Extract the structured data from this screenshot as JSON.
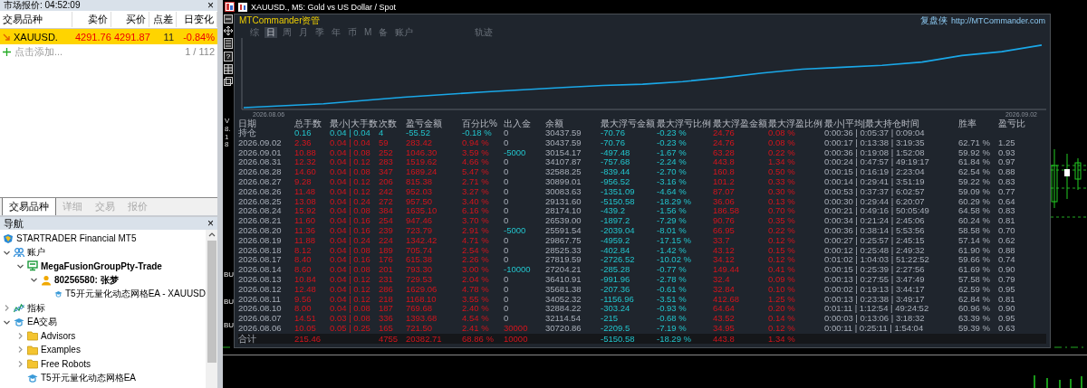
{
  "market_watch": {
    "title": "市场报价: 04:52:09",
    "close": "×",
    "columns": [
      "交易品种",
      "卖价",
      "买价",
      "点差",
      "日变化"
    ],
    "rows": [
      {
        "symbol": "XAUUSD.",
        "bid": "4291.76",
        "ask": "4291.87",
        "spread": "11",
        "change": "-0.84%",
        "falling": true,
        "selected": true
      }
    ],
    "add_label": "点击添加...",
    "count": "1 / 112",
    "tabs": [
      {
        "label": "交易品种",
        "selected": true
      },
      {
        "label": "详细",
        "selected": false
      },
      {
        "label": "交易",
        "selected": false
      },
      {
        "label": "报价",
        "selected": false
      }
    ]
  },
  "navigator": {
    "title": "导航",
    "close": "×",
    "tree": [
      {
        "label": "STARTRADER Financial MT5",
        "kind": "broker",
        "current": false
      },
      {
        "label": "账户",
        "kind": "accounts",
        "expanded": true,
        "current": false,
        "children": [
          {
            "label": "MegaFusionGroupPty-Trade",
            "kind": "server",
            "expanded": true,
            "current": true,
            "children": [
              {
                "label": "80256580: 张梦",
                "kind": "user",
                "expanded": true,
                "current": true,
                "children": [
                  {
                    "label": "T5开元量化动态网格EA - XAUUSD",
                    "kind": "expert",
                    "current": false
                  }
                ]
              }
            ]
          }
        ]
      },
      {
        "label": "指标",
        "kind": "indicators",
        "expanded": false,
        "current": false
      },
      {
        "label": "EA交易",
        "kind": "expert",
        "expanded": true,
        "current": false,
        "children": [
          {
            "label": "Advisors",
            "kind": "folder",
            "expanded": false,
            "current": false
          },
          {
            "label": "Examples",
            "kind": "folder",
            "expanded": false,
            "current": false
          },
          {
            "label": "Free Robots",
            "kind": "folder",
            "expanded": false,
            "current": false
          },
          {
            "label": "T5开元量化动态网格EA",
            "kind": "expert",
            "current": false
          }
        ]
      }
    ]
  },
  "chart_window": {
    "title": "XAUUSD., M5: Gold vs US Dollar / Spot",
    "toolbar_help": "?",
    "version": "V8.18",
    "chart_labels": [
      "BU",
      "BU",
      "BU"
    ],
    "panel": {
      "title": "MTCommander资管",
      "brand": "复盘侠",
      "url": "http://MTCommander.com",
      "tabs": [
        {
          "label": "综",
          "selected": false
        },
        {
          "label": "日",
          "selected": true
        },
        {
          "label": "周",
          "selected": false
        },
        {
          "label": "月",
          "selected": false
        },
        {
          "label": "季",
          "selected": false
        },
        {
          "label": "年",
          "selected": false
        },
        {
          "label": "币",
          "selected": false
        },
        {
          "label": "M",
          "selected": false
        },
        {
          "label": "备",
          "selected": false
        },
        {
          "label": "账户",
          "selected": false
        },
        {
          "label": "轨迹",
          "selected": false
        }
      ],
      "equity_chart": {
        "start_label": "2026.08.06",
        "end_label": "2026.09.02"
      },
      "columns": [
        "日期",
        "总手数",
        "最小|大手数",
        "次数",
        "盈亏金额",
        "百分比%",
        "出入金",
        "余额",
        "最大浮亏金额",
        "最大浮亏比例",
        "最大浮盈金额",
        "最大浮盈比例",
        "最小|平均|最大持仓时间",
        "胜率",
        "盈亏比"
      ],
      "rows": [
        {
          "kind": "holding",
          "loss": true,
          "cash_in": false,
          "cash_out": false,
          "date": "持仓",
          "lots": "0.16",
          "lot_range": "0.04 | 0.04",
          "trades": "4",
          "pnl": "-55.52",
          "pct": "-0.18 %",
          "cash_flow": "0",
          "balance": "30437.59",
          "max_float_loss": "-70.76",
          "max_float_loss_pct": "-0.23 %",
          "max_float_profit": "24.76",
          "max_float_profit_pct": "0.08 %",
          "hold_times": "0:00:36 | 0:05:37 | 0:09:04"
        },
        {
          "kind": "day",
          "date": "2026.09.02",
          "loss": false,
          "cash_in": false,
          "cash_out": false,
          "lots": "2.36",
          "lot_range": "0.04 | 0.04",
          "trades": "59",
          "pnl": "283.42",
          "pct": "0.94 %",
          "cash_flow": "0",
          "balance": "30437.59",
          "max_float_loss": "-70.76",
          "max_float_loss_pct": "-0.23 %",
          "max_float_profit": "24.76",
          "max_float_profit_pct": "0.08 %",
          "hold_times": "0:00:17 | 0:13:38 | 3:19:35",
          "win_rate": "62.71 %",
          "pl_ratio": "1.25"
        },
        {
          "kind": "day",
          "date": "2026.09.01",
          "loss": false,
          "cash_in": false,
          "cash_out": true,
          "lots": "10.88",
          "lot_range": "0.04 | 0.08",
          "trades": "252",
          "pnl": "1046.30",
          "pct": "3.59 %",
          "cash_flow": "-5000",
          "balance": "30154.17",
          "max_float_loss": "-497.48",
          "max_float_loss_pct": "-1.67 %",
          "max_float_profit": "63.28",
          "max_float_profit_pct": "0.22 %",
          "hold_times": "0:00:36 | 0:19:08 | 1:52:08",
          "win_rate": "59.92 %",
          "pl_ratio": "0.93"
        },
        {
          "kind": "day",
          "date": "2026.08.31",
          "loss": false,
          "cash_in": false,
          "cash_out": false,
          "lots": "12.32",
          "lot_range": "0.04 | 0.12",
          "trades": "283",
          "pnl": "1519.62",
          "pct": "4.66 %",
          "cash_flow": "0",
          "balance": "34107.87",
          "max_float_loss": "-757.68",
          "max_float_loss_pct": "-2.24 %",
          "max_float_profit": "443.8",
          "max_float_profit_pct": "1.34 %",
          "hold_times": "0:00:24 | 0:47:57 | 49:19:17",
          "win_rate": "61.84 %",
          "pl_ratio": "0.97"
        },
        {
          "kind": "day",
          "date": "2026.08.28",
          "loss": false,
          "cash_in": false,
          "cash_out": false,
          "lots": "14.60",
          "lot_range": "0.04 | 0.08",
          "trades": "347",
          "pnl": "1689.24",
          "pct": "5.47 %",
          "cash_flow": "0",
          "balance": "32588.25",
          "max_float_loss": "-839.44",
          "max_float_loss_pct": "-2.70 %",
          "max_float_profit": "160.8",
          "max_float_profit_pct": "0.50 %",
          "hold_times": "0:00:15 | 0:16:19 | 2:23:04",
          "win_rate": "62.54 %",
          "pl_ratio": "0.88"
        },
        {
          "kind": "day",
          "date": "2026.08.27",
          "loss": false,
          "cash_in": false,
          "cash_out": false,
          "lots": "9.28",
          "lot_range": "0.04 | 0.12",
          "trades": "206",
          "pnl": "815.38",
          "pct": "2.71 %",
          "cash_flow": "0",
          "balance": "30899.01",
          "max_float_loss": "-956.52",
          "max_float_loss_pct": "-3.16 %",
          "max_float_profit": "101.2",
          "max_float_profit_pct": "0.33 %",
          "hold_times": "0:00:14 | 0:29:41 | 3:51:19",
          "win_rate": "59.22 %",
          "pl_ratio": "0.83"
        },
        {
          "kind": "day",
          "date": "2026.08.26",
          "loss": false,
          "cash_in": false,
          "cash_out": false,
          "lots": "11.48",
          "lot_range": "0.04 | 0.12",
          "trades": "242",
          "pnl": "952.03",
          "pct": "3.27 %",
          "cash_flow": "0",
          "balance": "30083.63",
          "max_float_loss": "-1351.09",
          "max_float_loss_pct": "-4.64 %",
          "max_float_profit": "87.07",
          "max_float_profit_pct": "0.30 %",
          "hold_times": "0:00:53 | 0:37:37 | 6:02:57",
          "win_rate": "59.09 %",
          "pl_ratio": "0.77"
        },
        {
          "kind": "day",
          "date": "2026.08.25",
          "loss": false,
          "cash_in": false,
          "cash_out": false,
          "lots": "13.08",
          "lot_range": "0.04 | 0.24",
          "trades": "272",
          "pnl": "957.50",
          "pct": "3.40 %",
          "cash_flow": "0",
          "balance": "29131.60",
          "max_float_loss": "-5150.58",
          "max_float_loss_pct": "-18.29 %",
          "max_float_profit": "36.06",
          "max_float_profit_pct": "0.13 %",
          "hold_times": "0:00:30 | 0:29:44 | 6:20:07",
          "win_rate": "60.29 %",
          "pl_ratio": "0.64"
        },
        {
          "kind": "day",
          "date": "2026.08.24",
          "loss": false,
          "cash_in": false,
          "cash_out": false,
          "lots": "15.92",
          "lot_range": "0.04 | 0.08",
          "trades": "384",
          "pnl": "1635.10",
          "pct": "6.16 %",
          "cash_flow": "0",
          "balance": "28174.10",
          "max_float_loss": "-439.2",
          "max_float_loss_pct": "-1.56 %",
          "max_float_profit": "186.58",
          "max_float_profit_pct": "0.70 %",
          "hold_times": "0:00:21 | 0:49:16 | 50:05:49",
          "win_rate": "64.58 %",
          "pl_ratio": "0.83"
        },
        {
          "kind": "day",
          "date": "2026.08.21",
          "loss": false,
          "cash_in": false,
          "cash_out": false,
          "lots": "11.60",
          "lot_range": "0.04 | 0.16",
          "trades": "254",
          "pnl": "947.46",
          "pct": "3.70 %",
          "cash_flow": "0",
          "balance": "26539.00",
          "max_float_loss": "-1897.2",
          "max_float_loss_pct": "-7.29 %",
          "max_float_profit": "90.76",
          "max_float_profit_pct": "0.35 %",
          "hold_times": "0:00:34 | 0:21:24 | 2:45:06",
          "win_rate": "60.24 %",
          "pl_ratio": "0.81"
        },
        {
          "kind": "day",
          "date": "2026.08.20",
          "loss": false,
          "cash_in": false,
          "cash_out": true,
          "lots": "11.36",
          "lot_range": "0.04 | 0.16",
          "trades": "239",
          "pnl": "723.79",
          "pct": "2.91 %",
          "cash_flow": "-5000",
          "balance": "25591.54",
          "max_float_loss": "-2039.04",
          "max_float_loss_pct": "-8.01 %",
          "max_float_profit": "66.95",
          "max_float_profit_pct": "0.22 %",
          "hold_times": "0:00:36 | 0:38:14 | 5:53:56",
          "win_rate": "58.58 %",
          "pl_ratio": "0.70"
        },
        {
          "kind": "day",
          "date": "2026.08.19",
          "loss": false,
          "cash_in": false,
          "cash_out": false,
          "lots": "11.88",
          "lot_range": "0.04 | 0.24",
          "trades": "224",
          "pnl": "1342.42",
          "pct": "4.71 %",
          "cash_flow": "0",
          "balance": "29867.75",
          "max_float_loss": "-4959.2",
          "max_float_loss_pct": "-17.15 %",
          "max_float_profit": "33.7",
          "max_float_profit_pct": "0.12 %",
          "hold_times": "0:00:27 | 0:25:57 | 2:45:15",
          "win_rate": "57.14 %",
          "pl_ratio": "0.62"
        },
        {
          "kind": "day",
          "date": "2026.08.18",
          "loss": false,
          "cash_in": false,
          "cash_out": false,
          "lots": "8.12",
          "lot_range": "0.04 | 0.08",
          "trades": "189",
          "pnl": "705.74",
          "pct": "2.54 %",
          "cash_flow": "0",
          "balance": "28525.33",
          "max_float_loss": "-402.84",
          "max_float_loss_pct": "-1.42 %",
          "max_float_profit": "43.12",
          "max_float_profit_pct": "0.15 %",
          "hold_times": "0:00:12 | 0:25:48 | 2:49:32",
          "win_rate": "61.90 %",
          "pl_ratio": "0.88"
        },
        {
          "kind": "day",
          "date": "2026.08.17",
          "loss": false,
          "cash_in": false,
          "cash_out": false,
          "lots": "8.40",
          "lot_range": "0.04 | 0.16",
          "trades": "176",
          "pnl": "615.38",
          "pct": "2.26 %",
          "cash_flow": "0",
          "balance": "27819.59",
          "max_float_loss": "-2726.52",
          "max_float_loss_pct": "-10.02 %",
          "max_float_profit": "34.12",
          "max_float_profit_pct": "0.12 %",
          "hold_times": "0:01:02 | 1:04:03 | 51:22:52",
          "win_rate": "59.66 %",
          "pl_ratio": "0.74"
        },
        {
          "kind": "day",
          "date": "2026.08.14",
          "loss": false,
          "cash_in": false,
          "cash_out": true,
          "lots": "8.60",
          "lot_range": "0.04 | 0.08",
          "trades": "201",
          "pnl": "793.30",
          "pct": "3.00 %",
          "cash_flow": "-10000",
          "balance": "27204.21",
          "max_float_loss": "-285.28",
          "max_float_loss_pct": "-0.77 %",
          "max_float_profit": "149.44",
          "max_float_profit_pct": "0.41 %",
          "hold_times": "0:00:15 | 0:25:39 | 2:27:56",
          "win_rate": "61.69 %",
          "pl_ratio": "0.90"
        },
        {
          "kind": "day",
          "date": "2026.08.13",
          "loss": false,
          "cash_in": false,
          "cash_out": false,
          "lots": "10.84",
          "lot_range": "0.04 | 0.12",
          "trades": "231",
          "pnl": "729.53",
          "pct": "2.04 %",
          "cash_flow": "0",
          "balance": "36410.91",
          "max_float_loss": "-991.96",
          "max_float_loss_pct": "-2.78 %",
          "max_float_profit": "32.4",
          "max_float_profit_pct": "0.09 %",
          "hold_times": "0:00:13 | 0:27:55 | 3:47:49",
          "win_rate": "57.58 %",
          "pl_ratio": "0.79"
        },
        {
          "kind": "day",
          "date": "2026.08.12",
          "loss": false,
          "cash_in": false,
          "cash_out": false,
          "lots": "12.48",
          "lot_range": "0.04 | 0.12",
          "trades": "286",
          "pnl": "1629.06",
          "pct": "4.78 %",
          "cash_flow": "0",
          "balance": "35681.38",
          "max_float_loss": "-207.36",
          "max_float_loss_pct": "-0.61 %",
          "max_float_profit": "32.84",
          "max_float_profit_pct": "0.10 %",
          "hold_times": "0:00:02 | 0:19:13 | 3:44:17",
          "win_rate": "62.59 %",
          "pl_ratio": "0.95"
        },
        {
          "kind": "day",
          "date": "2026.08.11",
          "loss": false,
          "cash_in": false,
          "cash_out": false,
          "lots": "9.56",
          "lot_range": "0.04 | 0.12",
          "trades": "218",
          "pnl": "1168.10",
          "pct": "3.55 %",
          "cash_flow": "0",
          "balance": "34052.32",
          "max_float_loss": "-1156.96",
          "max_float_loss_pct": "-3.51 %",
          "max_float_profit": "412.68",
          "max_float_profit_pct": "1.25 %",
          "hold_times": "0:00:13 | 0:23:38 | 3:49:17",
          "win_rate": "62.84 %",
          "pl_ratio": "0.81"
        },
        {
          "kind": "day",
          "date": "2026.08.10",
          "loss": false,
          "cash_in": false,
          "cash_out": false,
          "lots": "8.00",
          "lot_range": "0.04 | 0.08",
          "trades": "187",
          "pnl": "769.68",
          "pct": "2.40 %",
          "cash_flow": "0",
          "balance": "32884.22",
          "max_float_loss": "-303.24",
          "max_float_loss_pct": "-0.93 %",
          "max_float_profit": "64.64",
          "max_float_profit_pct": "0.20 %",
          "hold_times": "0:01:11 | 1:12:54 | 49:24:52",
          "win_rate": "60.96 %",
          "pl_ratio": "0.90"
        },
        {
          "kind": "day",
          "date": "2026.08.07",
          "loss": false,
          "cash_in": false,
          "cash_out": false,
          "lots": "14.51",
          "lot_range": "0.03 | 0.08",
          "trades": "336",
          "pnl": "1393.68",
          "pct": "4.54 %",
          "cash_flow": "0",
          "balance": "32114.54",
          "max_float_loss": "-215",
          "max_float_loss_pct": "-0.68 %",
          "max_float_profit": "43.52",
          "max_float_profit_pct": "0.14 %",
          "hold_times": "0:00:03 | 0:13:06 | 3:18:32",
          "win_rate": "63.39 %",
          "pl_ratio": "0.95"
        },
        {
          "kind": "day",
          "date": "2026.08.06",
          "loss": false,
          "cash_in": true,
          "cash_out": false,
          "lots": "10.05",
          "lot_range": "0.05 | 0.25",
          "trades": "165",
          "pnl": "721.50",
          "pct": "2.41 %",
          "cash_flow": "30000",
          "balance": "30720.86",
          "max_float_loss": "-2209.5",
          "max_float_loss_pct": "-7.19 %",
          "max_float_profit": "34.95",
          "max_float_profit_pct": "0.12 %",
          "hold_times": "0:00:11 | 0:25:11 | 1:54:04",
          "win_rate": "59.39 %",
          "pl_ratio": "0.63"
        },
        {
          "kind": "total",
          "loss": false,
          "cash_in": true,
          "cash_out": false,
          "date": "合计",
          "lots": "215.46",
          "trades": "4755",
          "pnl": "20382.71",
          "pct": "68.86 %",
          "cash_flow": "10000",
          "max_float_loss": "-5150.58",
          "max_float_loss_pct": "-18.29 %",
          "max_float_profit": "443.8",
          "max_float_profit_pct": "1.34 %"
        }
      ]
    }
  }
}
